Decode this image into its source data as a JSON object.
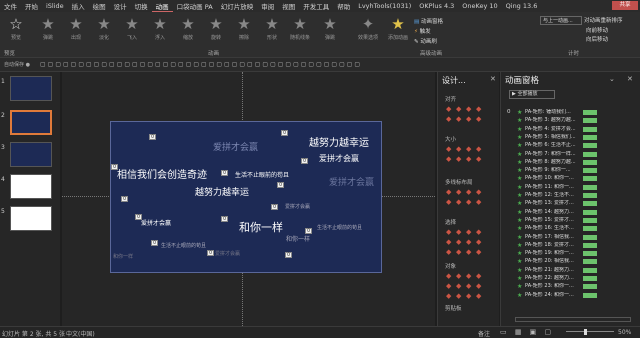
{
  "menu": [
    "文件",
    "开始",
    "iSlide",
    "插入",
    "绘图",
    "设计",
    "切换",
    "动画",
    "口袋动画 PA",
    "幻灯片放映",
    "审阅",
    "视图",
    "开发工具",
    "帮助",
    "LvyhTools(1031)",
    "OKPlus 4.3",
    "OneKey 10",
    "Qing 13.6"
  ],
  "active_menu": "动画",
  "share_label": "共享",
  "ribbon": {
    "preview": "预览",
    "preview_group": "预览",
    "animation_group": "动画",
    "advanced_group": "高级动画",
    "timing_group": "计时",
    "effects": [
      "弹跳",
      "出现",
      "淡化",
      "飞入",
      "浮入",
      "缩放",
      "旋转",
      "擦除",
      "形状",
      "随机线条",
      "弹跳"
    ],
    "effect_options": "效果选项",
    "add_animation": "添加动画",
    "animation_pane": "动画窗格",
    "trigger": "触发",
    "anim_painter": "动画刷",
    "start_label": "与上一动画...",
    "reorder": "对动画重新排序",
    "move_earlier": "向前移动",
    "move_later": "向后移动"
  },
  "thumbs": [
    "1",
    "2",
    "3",
    "4",
    "5"
  ],
  "slide": {
    "texts": [
      "爱拼才会赢",
      "越努力越幸运",
      "爱拼才会赢",
      "相信我们会创造奇迹",
      "生活不止眼前的苟且",
      "爱拼才会赢",
      "越努力越幸运",
      "和你一样",
      "爱拼才会赢",
      "生活不止眼前的苟且",
      "爱拼才会赢",
      "和你一样",
      "生活不止眼前的苟且",
      "和你一样",
      "爱拼才会赢",
      "越努力越幸运"
    ],
    "tag": "0"
  },
  "design": {
    "title": "设计...",
    "sections": [
      "对齐",
      "大小",
      "多线标布局",
      "选择",
      "对象",
      "剪贴板"
    ]
  },
  "anim_pane": {
    "title": "动画窗格",
    "play_all": "全部播放",
    "first_index": "0",
    "items": [
      "PA-矩形: 锤动我们...",
      "PA-矩形 3: 越努力越...",
      "PA-矩形 4: 爱拼才会...",
      "PA-矩形 5: 相信我们...",
      "PA-矩形 6: 生活不止...",
      "PA-矩形 7: 和你一样...",
      "PA-矩形 8: 越努力越...",
      "PA-矩形 9: 和你一...",
      "PA-矩形 10: 和你一...",
      "PA-矩形 11: 和你一...",
      "PA-矩形 12: 生活不...",
      "PA-矩形 13: 爱拼才...",
      "PA-矩形 14: 越努力...",
      "PA-矩形 15: 爱拼才...",
      "PA-矩形 16: 生活不...",
      "PA-矩形 17: 相信我...",
      "PA-矩形 18: 爱拼才...",
      "PA-矩形 19: 和你一...",
      "PA-矩形 20: 相信我...",
      "PA-矩形 21: 越努力...",
      "PA-矩形 22: 越努力...",
      "PA-矩形 23: 和你一...",
      "PA-矩形 24: 和你一..."
    ]
  },
  "status": {
    "slide_info": "幻灯片 第 2 张, 共 5 张",
    "lang": "中文(中国)",
    "notes": "备注",
    "zoom": "50%"
  },
  "colors": {
    "slide_bg": "#1d2a55",
    "accent": "#c0504d",
    "bar": "#6cc36c"
  }
}
